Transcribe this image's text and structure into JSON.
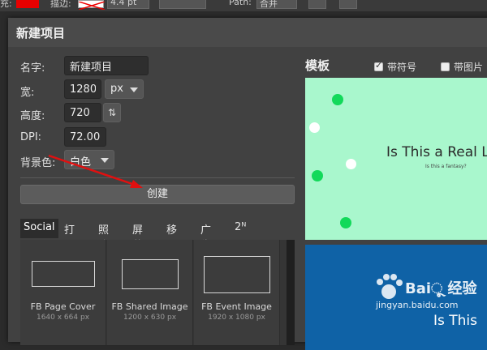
{
  "toolbar": {
    "fill_label": "充:",
    "fill_color": "#e80000",
    "stroke_label": "描边:",
    "stroke_width": "4.4 pt",
    "path_label": "Path:",
    "path_value": "合并"
  },
  "dialog": {
    "title": "新建项目",
    "name_label": "名字:",
    "name_value": "新建项目",
    "width_label": "宽:",
    "width_value": "1280",
    "unit_value": "px",
    "height_label": "高度:",
    "height_value": "720",
    "swap_icon": "⇅",
    "dpi_label": "DPI:",
    "dpi_value": "72.000",
    "bg_label": "背景色:",
    "bg_value": "白色",
    "create_label": "创建"
  },
  "tabs": [
    "Social",
    "打印",
    "照片",
    "屏幕",
    "移动",
    "广告",
    "2ᴺ"
  ],
  "presets": [
    {
      "name": "FB Page Cover",
      "size": "1640 x 664 px"
    },
    {
      "name": "FB Shared Image",
      "size": "1200 x 630 px"
    },
    {
      "name": "FB Event Image",
      "size": "1920 x 1080 px"
    }
  ],
  "templates": {
    "heading": "模板",
    "with_symbol_label": "带符号",
    "with_symbol_checked": true,
    "with_image_label": "带图片",
    "with_image_checked": false,
    "card1_title": "Is This a Real L",
    "card1_subtitle": "Is this a fantasy?",
    "card2_title": "Is This"
  },
  "watermark": {
    "brand": "Baiૂ 经验",
    "url": "jingyan.baidu.com"
  },
  "colors": {
    "accent_arrow": "#e01010",
    "card1_bg": "#a9f7cd",
    "card2_bg": "#0f62a6",
    "dot_green": "#12d95a"
  }
}
